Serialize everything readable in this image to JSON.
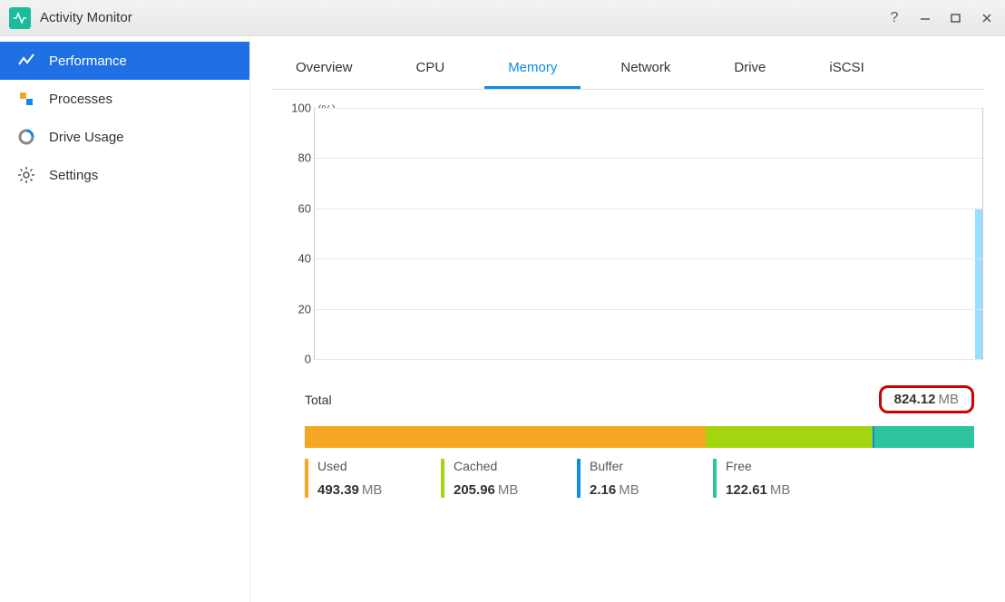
{
  "app": {
    "title": "Activity Monitor"
  },
  "sidebar": {
    "items": [
      {
        "label": "Performance",
        "active": true
      },
      {
        "label": "Processes",
        "active": false
      },
      {
        "label": "Drive Usage",
        "active": false
      },
      {
        "label": "Settings",
        "active": false
      }
    ]
  },
  "tabs": {
    "items": [
      {
        "label": "Overview"
      },
      {
        "label": "CPU"
      },
      {
        "label": "Memory"
      },
      {
        "label": "Network"
      },
      {
        "label": "Drive"
      },
      {
        "label": "iSCSI"
      }
    ],
    "active_index": 2
  },
  "chart_data": {
    "type": "line",
    "title": "",
    "xlabel": "",
    "ylabel": "(%)",
    "ylim": [
      0,
      100
    ],
    "y_ticks": [
      0,
      20,
      40,
      60,
      80,
      100
    ],
    "series": [
      {
        "name": "Memory %",
        "values": [
          60
        ],
        "color": "#7fd7ff"
      }
    ]
  },
  "memory": {
    "total_label": "Total",
    "total_value": "824.12",
    "total_unit": "MB",
    "breakdown": [
      {
        "label": "Used",
        "value": "493.39",
        "unit": "MB",
        "color": "#f5a623",
        "mb": 493.39
      },
      {
        "label": "Cached",
        "value": "205.96",
        "unit": "MB",
        "color": "#a4d50f",
        "mb": 205.96
      },
      {
        "label": "Buffer",
        "value": "2.16",
        "unit": "MB",
        "color": "#0d8be6",
        "mb": 2.16
      },
      {
        "label": "Free",
        "value": "122.61",
        "unit": "MB",
        "color": "#2ec4a0",
        "mb": 122.61
      }
    ],
    "total_mb": 824.12
  }
}
